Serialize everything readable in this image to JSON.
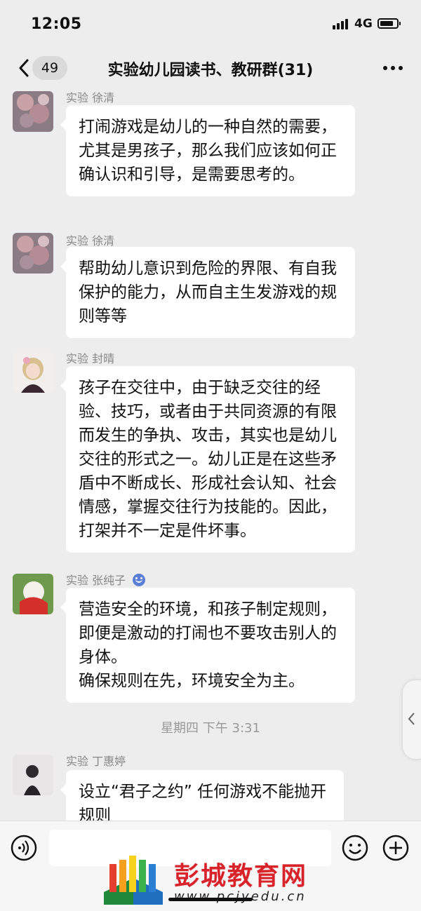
{
  "status_bar": {
    "time": "12:05",
    "network": "4G"
  },
  "header": {
    "back_count": "49",
    "title": "实验幼儿园读书、教研群(31)"
  },
  "messages": [
    {
      "sender": "实验 徐清",
      "text": "打闹游戏是幼儿的一种自然的需要，尤其是男孩子，那么我们应该如何正确认识和引导，是需要思考的。"
    },
    {
      "sender": "实验 徐清",
      "text": "帮助幼儿意识到危险的界限、有自我保护的能力，从而自主生发游戏的规则等等"
    },
    {
      "sender": "实验 封晴",
      "text": "孩子在交往中，由于缺乏交往的经验、技巧，或者由于共同资源的有限而发生的争执、攻击，其实也是幼儿交往的形式之一。幼儿正是在这些矛盾中不断成长、形成社会认知、社会情感，掌握交往行为技能的。因此，打架并不一定是件坏事。"
    },
    {
      "sender": "实验 张纯子",
      "text": "营造安全的环境，和孩子制定规则，即便是激动的打闹也不要攻击别人的身体。\n确保规则在先，环境安全为主。"
    },
    {
      "sender": "实验 丁惠婷",
      "text": "设立“君子之约” 任何游戏不能抛开规则"
    }
  ],
  "timestamp": "星期四 下午 3:31",
  "input": {
    "value": ""
  },
  "watermark": {
    "name": "彭城教育网",
    "url": "www.pcjyedu.cn"
  },
  "icons": {
    "back": "chevron-left-icon",
    "more": "more-icon",
    "voice": "voice-icon",
    "emoji": "emoji-icon",
    "plus": "plus-icon",
    "badge": "smile-badge-icon",
    "side": "chevron-left-icon"
  },
  "colors": {
    "background": "#ededed",
    "bubble": "#ffffff",
    "watermark_red": "#d9232b"
  }
}
